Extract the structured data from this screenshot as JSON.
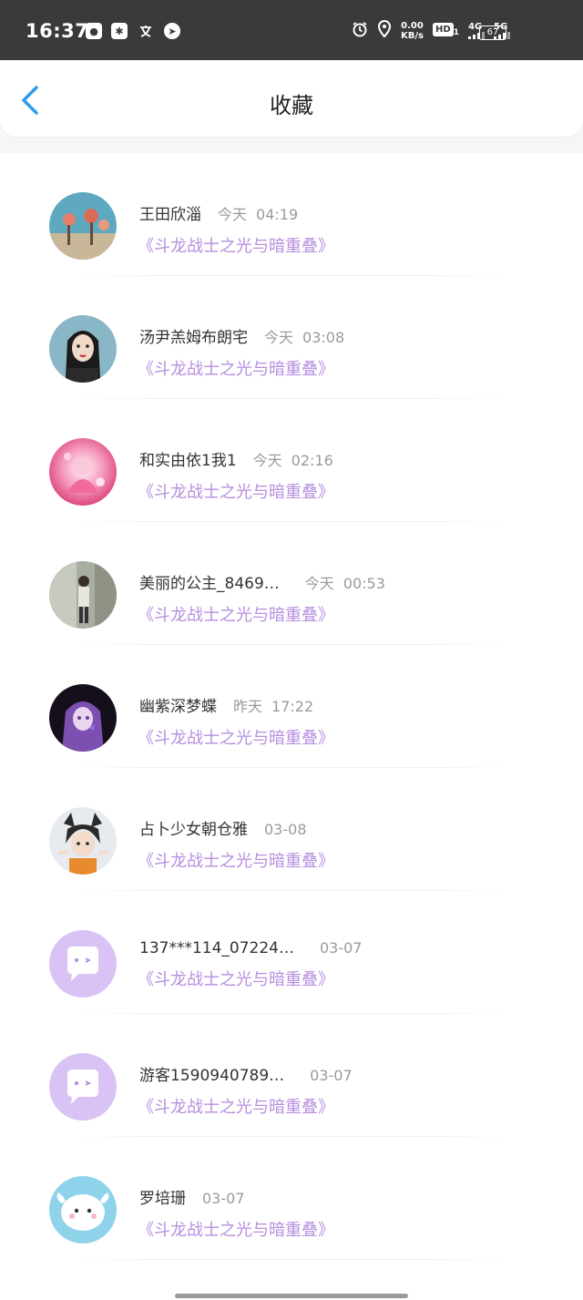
{
  "status_bar": {
    "time": "16:37",
    "net_speed_value": "0.00",
    "net_speed_unit": "KB/s",
    "hd": "HD",
    "hd_sub": "1",
    "sig1": "4G",
    "sig2": "5G",
    "battery": "67"
  },
  "header": {
    "title": "收藏"
  },
  "items": [
    {
      "name": "王田欣淄",
      "day": "今天",
      "time": "04:19",
      "work": "《斗龙战士之光与暗重叠》",
      "avatar": "photo-beach"
    },
    {
      "name": "汤尹羔姆布朗宅",
      "day": "今天",
      "time": "03:08",
      "work": "《斗龙战士之光与暗重叠》",
      "avatar": "illustration-girl"
    },
    {
      "name": "和实由依1我1",
      "day": "今天",
      "time": "02:16",
      "work": "《斗龙战士之光与暗重叠》",
      "avatar": "pink-anime"
    },
    {
      "name": "美丽的公主_8469…",
      "day": "今天",
      "time": "00:53",
      "work": "《斗龙战士之光与暗重叠》",
      "avatar": "photo-person"
    },
    {
      "name": "幽紫深梦蝶",
      "day": "昨天",
      "time": "17:22",
      "work": "《斗龙战士之光与暗重叠》",
      "avatar": "purple-anime"
    },
    {
      "name": "占卜少女朝仓雅",
      "day": "03-08",
      "time": "",
      "work": "《斗龙战士之光与暗重叠》",
      "avatar": "cat-boy"
    },
    {
      "name": "137***114_07224…",
      "day": "03-07",
      "time": "",
      "work": "《斗龙战士之光与暗重叠》",
      "avatar": "default-bubble"
    },
    {
      "name": "游客1590940789…",
      "day": "03-07",
      "time": "",
      "work": "《斗龙战士之光与暗重叠》",
      "avatar": "default-bubble"
    },
    {
      "name": "罗培珊",
      "day": "03-07",
      "time": "",
      "work": "《斗龙战士之光与暗重叠》",
      "avatar": "white-blob"
    }
  ],
  "colors": {
    "accent": "#2f9bea",
    "work_title": "#b78fe0",
    "default_avatar_bg": "#d9c3f5"
  }
}
